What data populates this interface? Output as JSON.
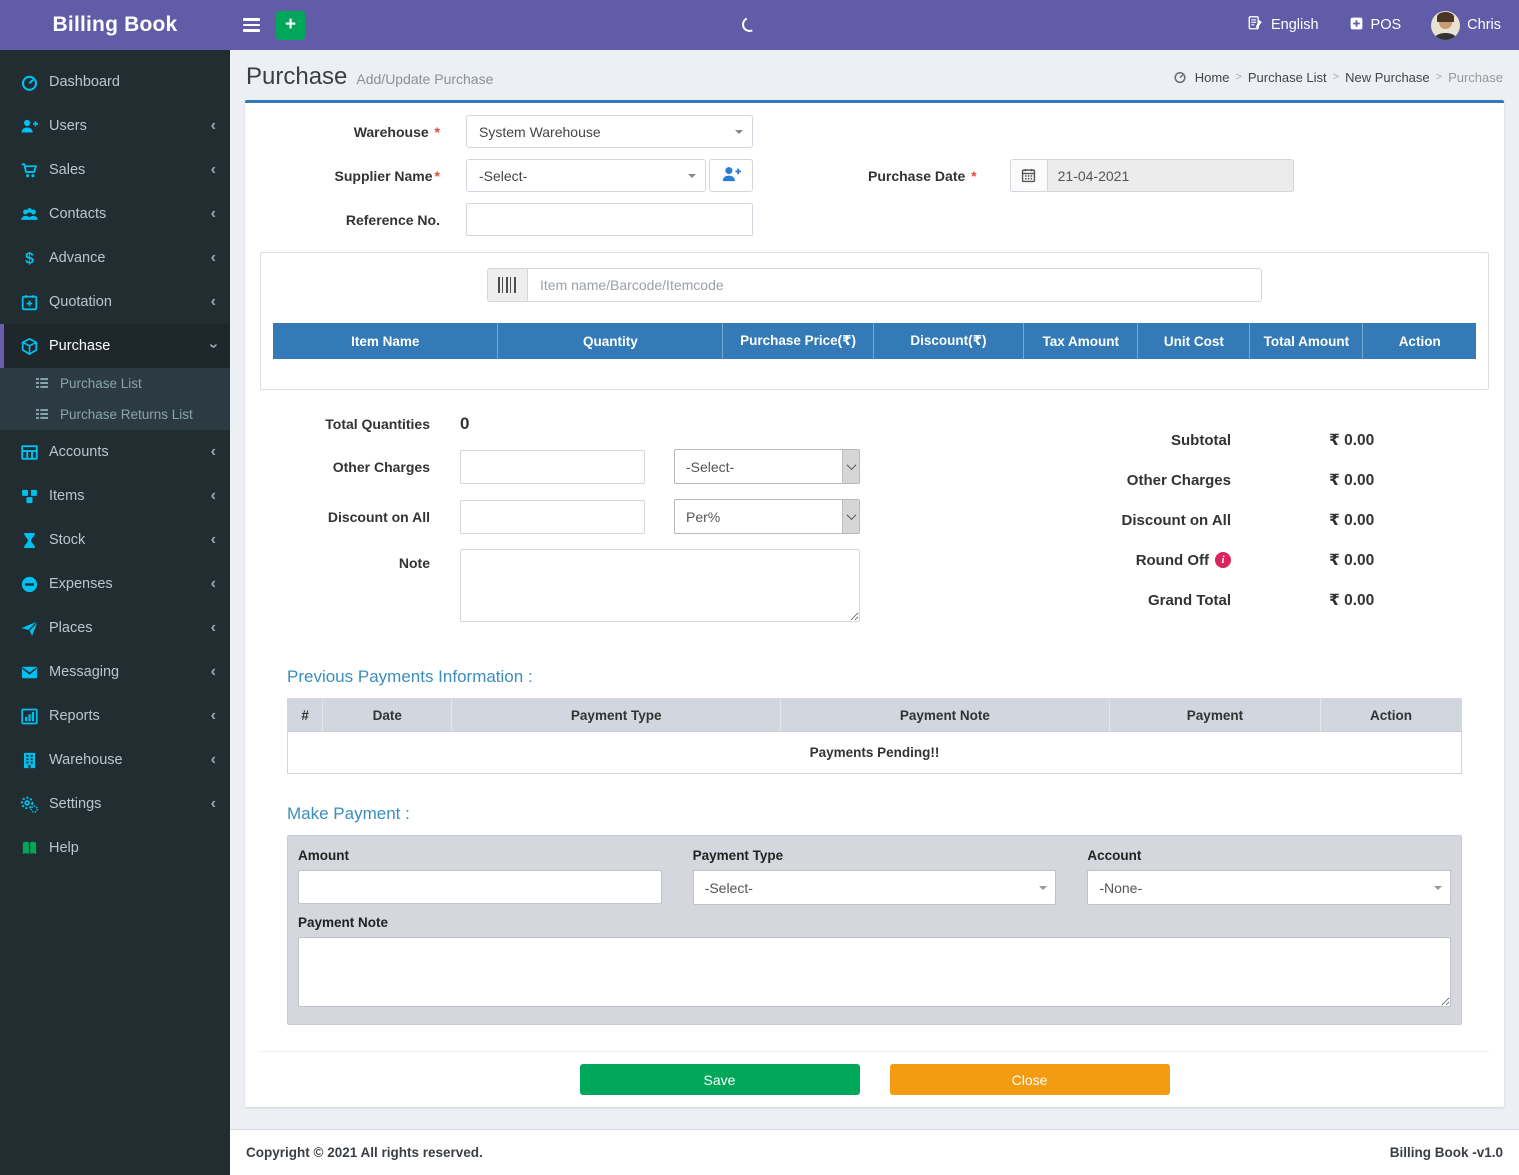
{
  "topbar": {
    "brand": "Billing Book",
    "quick_add": "+",
    "language": "English",
    "pos": "POS",
    "user": "Chris"
  },
  "sidebar": {
    "items": [
      {
        "label": "Dashboard",
        "icon": "dashboard-icon"
      },
      {
        "label": "Users",
        "icon": "user-plus-icon"
      },
      {
        "label": "Sales",
        "icon": "cart-icon"
      },
      {
        "label": "Contacts",
        "icon": "users-icon"
      },
      {
        "label": "Advance",
        "icon": "dollar-icon"
      },
      {
        "label": "Quotation",
        "icon": "calendar-plus-icon"
      },
      {
        "label": "Purchase",
        "icon": "cube-icon",
        "active": true,
        "children": [
          {
            "label": "Purchase List",
            "icon": "list-icon"
          },
          {
            "label": "Purchase Returns List",
            "icon": "list-icon"
          }
        ]
      },
      {
        "label": "Accounts",
        "icon": "table-icon"
      },
      {
        "label": "Items",
        "icon": "cubes-icon"
      },
      {
        "label": "Stock",
        "icon": "hourglass-icon"
      },
      {
        "label": "Expenses",
        "icon": "minus-circle-icon"
      },
      {
        "label": "Places",
        "icon": "paper-plane-icon"
      },
      {
        "label": "Messaging",
        "icon": "envelope-icon"
      },
      {
        "label": "Reports",
        "icon": "bar-chart-icon"
      },
      {
        "label": "Warehouse",
        "icon": "building-icon"
      },
      {
        "label": "Settings",
        "icon": "gears-icon"
      },
      {
        "label": "Help",
        "icon": "book-icon"
      }
    ]
  },
  "page_header": {
    "title": "Purchase",
    "subtitle": "Add/Update Purchase",
    "breadcrumb": [
      "Home",
      "Purchase List",
      "New Purchase",
      "Purchase"
    ]
  },
  "form": {
    "required_mark": "*",
    "warehouse_label": "Warehouse",
    "warehouse_value": "System Warehouse",
    "supplier_label": "Supplier Name",
    "supplier_value": "-Select-",
    "reference_label": "Reference No.",
    "purchase_date_label": "Purchase Date",
    "purchase_date_value": "21-04-2021",
    "item_search_placeholder": "Item name/Barcode/Itemcode"
  },
  "items_table": {
    "headers": [
      "Item Name",
      "Quantity",
      "Purchase Price(₹)",
      "Discount(₹)",
      "Tax Amount",
      "Unit Cost",
      "Total Amount",
      "Action"
    ]
  },
  "totals_form": {
    "total_quantities_label": "Total Quantities",
    "total_quantities_value": "0",
    "other_charges_label": "Other Charges",
    "other_charges_select": "-Select-",
    "discount_label": "Discount on All",
    "discount_select": "Per%",
    "note_label": "Note"
  },
  "summary": {
    "rows": [
      {
        "label": "Subtotal",
        "value": "₹ 0.00"
      },
      {
        "label": "Other Charges",
        "value": "₹ 0.00"
      },
      {
        "label": "Discount on All",
        "value": "₹ 0.00"
      },
      {
        "label": "Round Off",
        "value": "₹ 0.00"
      },
      {
        "label": "Grand Total",
        "value": "₹ 0.00"
      }
    ]
  },
  "previous_payments": {
    "title": "Previous Payments Information :",
    "headers": [
      "#",
      "Date",
      "Payment Type",
      "Payment Note",
      "Payment",
      "Action"
    ],
    "empty_message": "Payments Pending!!"
  },
  "make_payment": {
    "title": "Make Payment :",
    "amount_label": "Amount",
    "payment_type_label": "Payment Type",
    "payment_type_value": "-Select-",
    "account_label": "Account",
    "account_value": "-None-",
    "note_label": "Payment Note"
  },
  "actions": {
    "save_label": "Save",
    "close_label": "Close"
  },
  "footer": {
    "copyright": "Copyright © 2021 All rights reserved.",
    "version": "Billing Book -v1.0"
  },
  "colors": {
    "topbar": "#605ca8",
    "sidebar": "#222d32",
    "table_header": "#337ab7",
    "save_button": "#00a65a",
    "close_button": "#f39c12",
    "sidebar_icon": "#00c0ef",
    "required": "#dd4b39"
  }
}
